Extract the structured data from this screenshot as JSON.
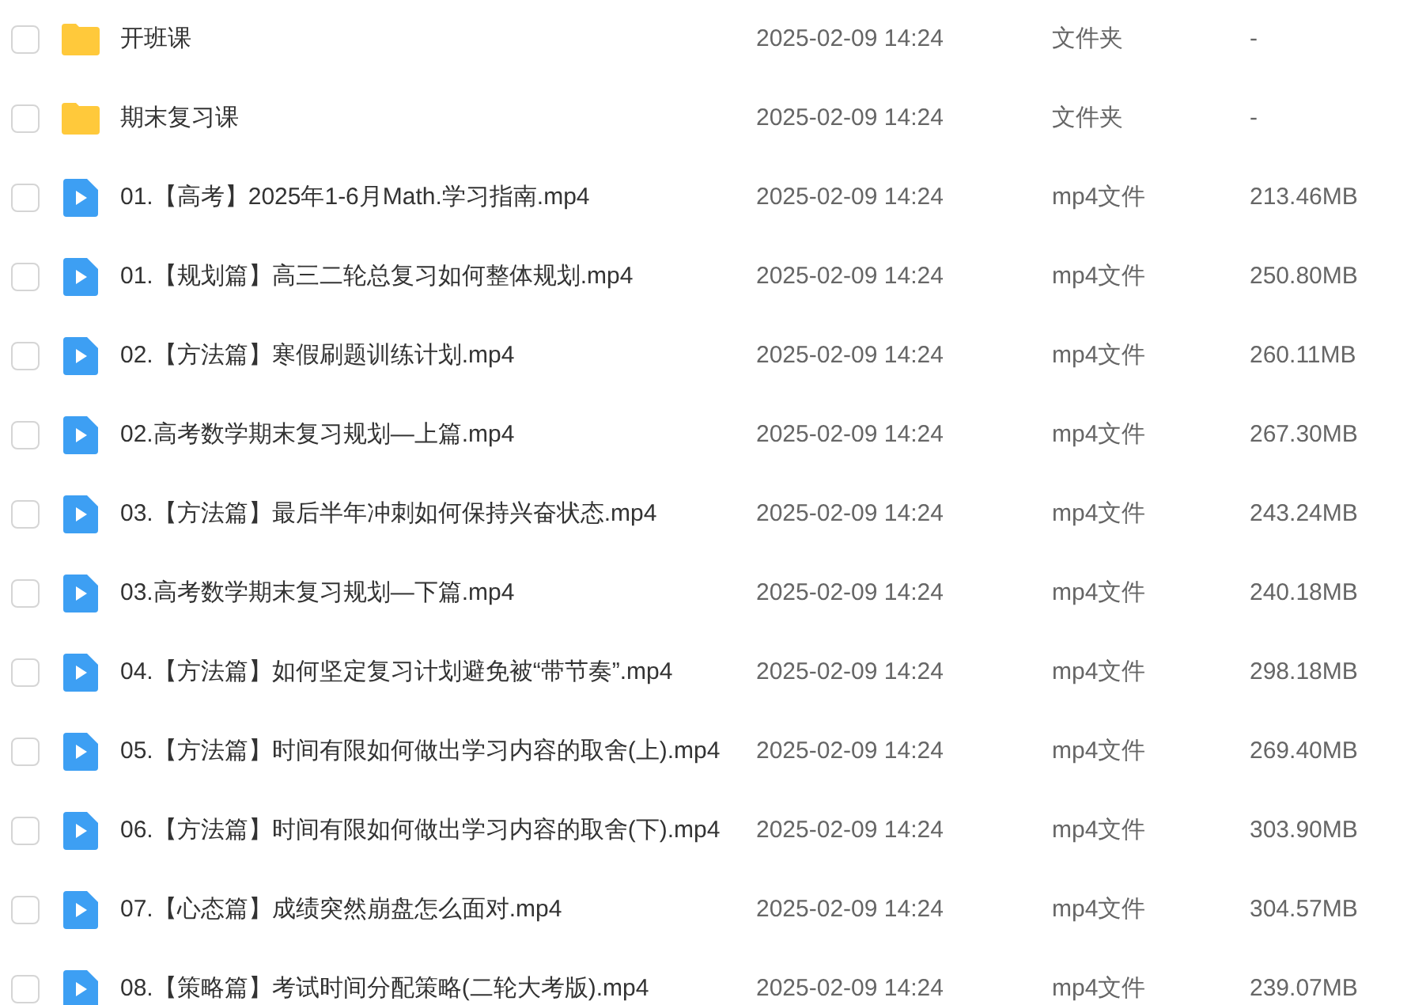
{
  "files": [
    {
      "kind": "folder",
      "checked": false,
      "name": "开班课",
      "modified": "2025-02-09 14:24",
      "type": "文件夹",
      "size": "-"
    },
    {
      "kind": "folder",
      "checked": false,
      "name": "期末复习课",
      "modified": "2025-02-09 14:24",
      "type": "文件夹",
      "size": "-"
    },
    {
      "kind": "video",
      "checked": false,
      "name": "01.【高考】2025年1-6月Math.学习指南.mp4",
      "modified": "2025-02-09 14:24",
      "type": "mp4文件",
      "size": "213.46MB"
    },
    {
      "kind": "video",
      "checked": false,
      "name": "01.【规划篇】高三二轮总复习如何整体规划.mp4",
      "modified": "2025-02-09 14:24",
      "type": "mp4文件",
      "size": "250.80MB"
    },
    {
      "kind": "video",
      "checked": false,
      "name": "02.【方法篇】寒假刷题训练计划.mp4",
      "modified": "2025-02-09 14:24",
      "type": "mp4文件",
      "size": "260.11MB"
    },
    {
      "kind": "video",
      "checked": false,
      "name": "02.高考数学期末复习规划—上篇.mp4",
      "modified": "2025-02-09 14:24",
      "type": "mp4文件",
      "size": "267.30MB"
    },
    {
      "kind": "video",
      "checked": false,
      "name": "03.【方法篇】最后半年冲刺如何保持兴奋状态.mp4",
      "modified": "2025-02-09 14:24",
      "type": "mp4文件",
      "size": "243.24MB"
    },
    {
      "kind": "video",
      "checked": false,
      "name": "03.高考数学期末复习规划—下篇.mp4",
      "modified": "2025-02-09 14:24",
      "type": "mp4文件",
      "size": "240.18MB"
    },
    {
      "kind": "video",
      "checked": false,
      "name": "04.【方法篇】如何坚定复习计划避免被“带节奏”.mp4",
      "modified": "2025-02-09 14:24",
      "type": "mp4文件",
      "size": "298.18MB"
    },
    {
      "kind": "video",
      "checked": false,
      "name": "05.【方法篇】时间有限如何做出学习内容的取舍(上).mp4",
      "modified": "2025-02-09 14:24",
      "type": "mp4文件",
      "size": "269.40MB"
    },
    {
      "kind": "video",
      "checked": false,
      "name": "06.【方法篇】时间有限如何做出学习内容的取舍(下).mp4",
      "modified": "2025-02-09 14:24",
      "type": "mp4文件",
      "size": "303.90MB"
    },
    {
      "kind": "video",
      "checked": false,
      "name": "07.【心态篇】成绩突然崩盘怎么面对.mp4",
      "modified": "2025-02-09 14:24",
      "type": "mp4文件",
      "size": "304.57MB"
    },
    {
      "kind": "video",
      "checked": false,
      "name": "08.【策略篇】考试时间分配策略(二轮大考版).mp4",
      "modified": "2025-02-09 14:24",
      "type": "mp4文件",
      "size": "239.07MB"
    }
  ]
}
